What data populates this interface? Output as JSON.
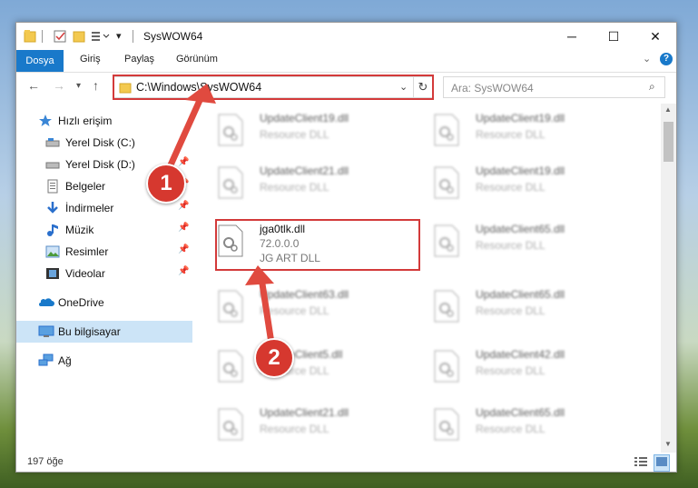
{
  "window": {
    "title": "SysWOW64"
  },
  "ribbon": {
    "tabs": [
      "Dosya",
      "Giriş",
      "Paylaş",
      "Görünüm"
    ]
  },
  "address": {
    "path": "C:\\Windows\\SysWOW64",
    "search_placeholder": "Ara: SysWOW64"
  },
  "nav": {
    "items": [
      {
        "label": "Hızlı erişim",
        "icon": "star-icon",
        "pinned": false
      },
      {
        "label": "Yerel Disk (C:)",
        "icon": "drive-icon",
        "pinned": false
      },
      {
        "label": "Yerel Disk (D:)",
        "icon": "drive-icon",
        "pinned": true
      },
      {
        "label": "Belgeler",
        "icon": "documents-icon",
        "pinned": true
      },
      {
        "label": "İndirmeler",
        "icon": "download-icon",
        "pinned": true
      },
      {
        "label": "Müzik",
        "icon": "music-icon",
        "pinned": true
      },
      {
        "label": "Resimler",
        "icon": "pictures-icon",
        "pinned": true
      },
      {
        "label": "Videolar",
        "icon": "videos-icon",
        "pinned": true
      },
      {
        "label": "OneDrive",
        "icon": "cloud-icon",
        "pinned": false
      },
      {
        "label": "Bu bilgisayar",
        "icon": "computer-icon",
        "pinned": false
      },
      {
        "label": "Ağ",
        "icon": "network-icon",
        "pinned": false
      }
    ]
  },
  "files": {
    "left": [
      {
        "name": "UpdateClient19.dll",
        "type": "Resource DLL"
      },
      {
        "name": "UpdateClient21.dll",
        "type": "Resource DLL"
      },
      {
        "name": "jga0tlk.dll",
        "version": "72.0.0.0",
        "type": "JG ART DLL"
      },
      {
        "name": "UpdateClient63.dll",
        "type": "Resource DLL"
      },
      {
        "name": "UpdateClient5.dll",
        "type": "Resource DLL"
      },
      {
        "name": "UpdateClient21.dll",
        "type": "Resource DLL"
      }
    ],
    "right": [
      {
        "name": "UpdateClient19.dll",
        "type": "Resource DLL"
      },
      {
        "name": "UpdateClient19.dll",
        "type": "Resource DLL"
      },
      {
        "name": "UpdateClient65.dll",
        "type": "Resource DLL"
      },
      {
        "name": "UpdateClient65.dll",
        "type": "Resource DLL"
      },
      {
        "name": "UpdateClient42.dll",
        "type": "Resource DLL"
      },
      {
        "name": "UpdateClient65.dll",
        "type": "Resource DLL"
      }
    ]
  },
  "status": {
    "count_text": "197 öğe"
  },
  "callouts": [
    "1",
    "2"
  ],
  "colors": {
    "accent": "#1979ca",
    "highlight": "#d33a3a",
    "selected_nav": "#cce4f7"
  }
}
